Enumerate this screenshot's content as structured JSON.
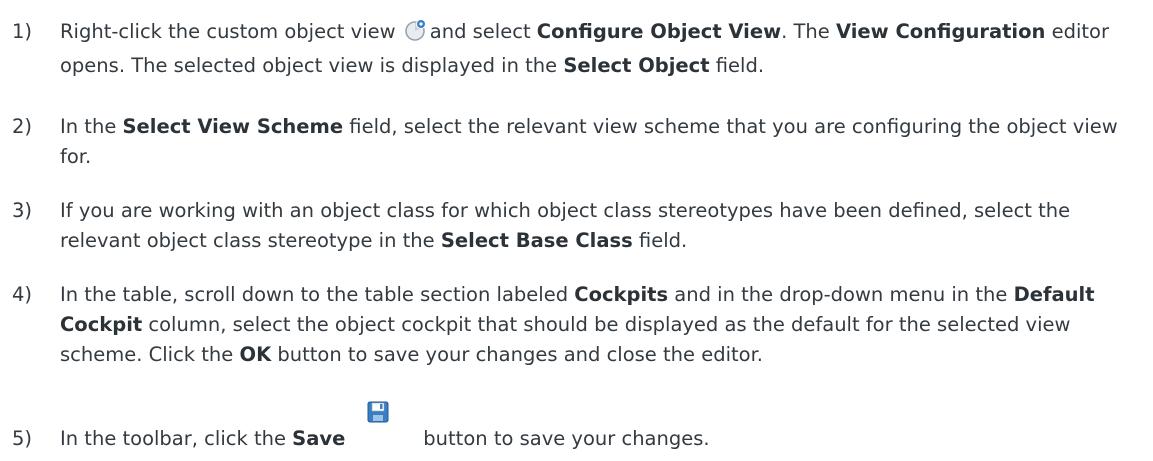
{
  "steps": [
    {
      "number": "1)",
      "s1_t1": "Right-click the custom object view",
      "s1_t2": "and select",
      "s1_b1": "Configure Object View",
      "s1_t3": ". The",
      "s1_b2": "View Configuration",
      "s1_t4": "editor opens. The selected object view is displayed in the",
      "s1_b3": "Select Object",
      "s1_t5": "field.",
      "icon": "object-view-icon"
    },
    {
      "number": "2)",
      "s2_t1": "In the",
      "s2_b1": "Select View Scheme",
      "s2_t2": "field, select the relevant view scheme that you are configuring the object view for."
    },
    {
      "number": "3)",
      "s3_t1": "If you are working with an object class for which object class stereotypes have been defined, select the relevant object class stereotype in the",
      "s3_b1": "Select Base Class",
      "s3_t2": "field."
    },
    {
      "number": "4)",
      "s4_t1": "In the table, scroll down to the table section labeled",
      "s4_b1": "Cockpits",
      "s4_t2": "and in the drop-down menu in the",
      "s4_b2": "Default Cockpit",
      "s4_t3": "column, select the object cockpit that should be displayed as the default for the selected view scheme. Click the",
      "s4_b3": "OK",
      "s4_t4": "button to save your changes and close the editor."
    },
    {
      "number": "5)",
      "s5_t1": "In the toolbar, click the",
      "s5_b1": "Save",
      "s5_t2": "button to save your changes.",
      "icon": "save-icon"
    }
  ],
  "colors": {
    "text": "#333a40",
    "icon_blue": "#3a7fc4",
    "icon_gray": "#9aa3ad"
  }
}
